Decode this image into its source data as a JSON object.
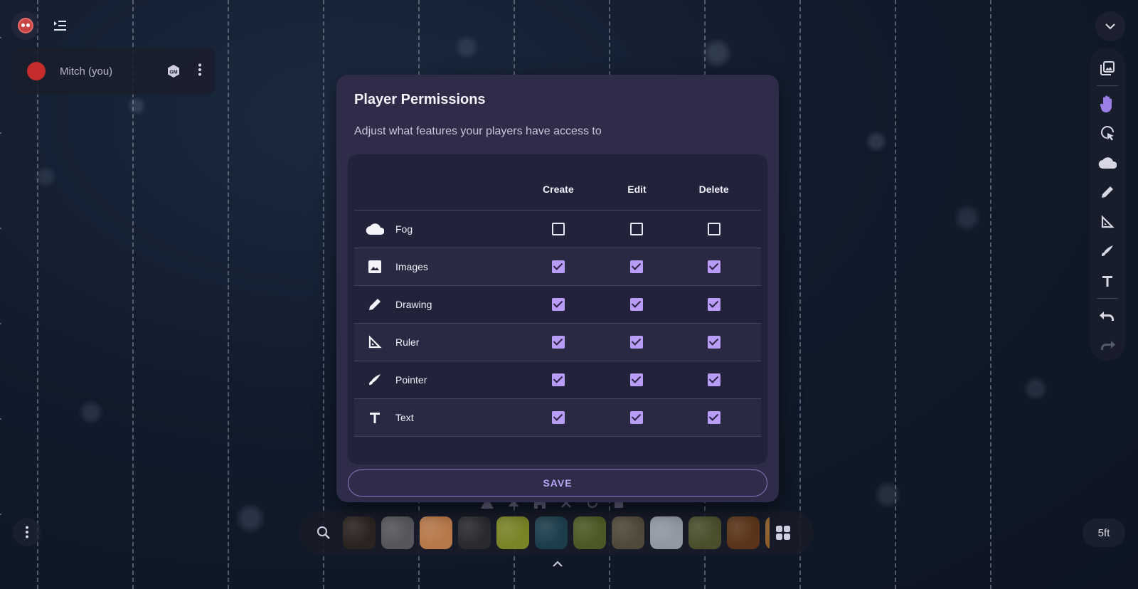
{
  "app": {
    "logo_icon": "owlbear-logo-icon",
    "menu_icon": "menu-indent-icon"
  },
  "player": {
    "name": "Mitch (you)",
    "color": "#c62c2c",
    "gm_badge_icon": "gm-shield-icon",
    "more_icon": "more-vertical-icon"
  },
  "toolbar": {
    "collapse_icon": "chevron-down-icon",
    "tools": [
      {
        "name": "images",
        "icon": "image-stack-icon"
      },
      {
        "name": "move",
        "icon": "hand-icon",
        "active": true
      },
      {
        "name": "measure-select",
        "icon": "select-pointer-icon"
      },
      {
        "name": "fog",
        "icon": "cloud-icon"
      },
      {
        "name": "drawing",
        "icon": "pencil-icon"
      },
      {
        "name": "ruler",
        "icon": "ruler-triangle-icon"
      },
      {
        "name": "pointer",
        "icon": "pointer-brush-icon"
      },
      {
        "name": "text",
        "icon": "text-icon"
      },
      {
        "name": "undo",
        "icon": "undo-icon"
      },
      {
        "name": "redo",
        "icon": "redo-icon",
        "disabled": true
      }
    ]
  },
  "modal": {
    "title": "Player Permissions",
    "subtitle": "Adjust what features your players have access to",
    "columns": [
      "Create",
      "Edit",
      "Delete"
    ],
    "rows": [
      {
        "label": "Fog",
        "icon": "cloud-icon",
        "create": false,
        "edit": false,
        "delete": false
      },
      {
        "label": "Images",
        "icon": "image-icon",
        "create": true,
        "edit": true,
        "delete": true
      },
      {
        "label": "Drawing",
        "icon": "pencil-icon",
        "create": true,
        "edit": true,
        "delete": true
      },
      {
        "label": "Ruler",
        "icon": "ruler-triangle-icon",
        "create": true,
        "edit": true,
        "delete": true
      },
      {
        "label": "Pointer",
        "icon": "pointer-brush-icon",
        "create": true,
        "edit": true,
        "delete": true
      },
      {
        "label": "Text",
        "icon": "text-icon",
        "create": true,
        "edit": true,
        "delete": true
      }
    ],
    "save_label": "SAVE"
  },
  "bottom": {
    "menu_icon": "more-vertical-icon",
    "scale_label": "5ft",
    "search_icon": "search-icon",
    "grid_icon": "grid-icon",
    "expand_icon": "chevron-up-icon",
    "category_icons": [
      "warning-icon",
      "tree-icon",
      "building-icon",
      "crossed-swords-icon",
      "refresh-icon",
      "note-icon"
    ],
    "tiles": [
      {
        "name": "dark-earth",
        "color": "#2a231f"
      },
      {
        "name": "gravel",
        "color": "#55555a"
      },
      {
        "name": "sand",
        "color": "#b7784a"
      },
      {
        "name": "dark-stone",
        "color": "#2a2a2e"
      },
      {
        "name": "moss",
        "color": "#7a8326"
      },
      {
        "name": "water",
        "color": "#1c3d4c"
      },
      {
        "name": "grass",
        "color": "#4b5a24"
      },
      {
        "name": "rocky-ground",
        "color": "#504838"
      },
      {
        "name": "snow",
        "color": "#9098a2"
      },
      {
        "name": "leafy-ground",
        "color": "#4a4e2c"
      },
      {
        "name": "wood",
        "color": "#5a3418"
      },
      {
        "name": "dirt",
        "color": "#8a5a2a"
      }
    ]
  },
  "colors": {
    "accent": "#b89cf6",
    "modal_bg": "#2e2c48",
    "table_bg": "#22223a",
    "active_tool": "#9c7fe6"
  }
}
